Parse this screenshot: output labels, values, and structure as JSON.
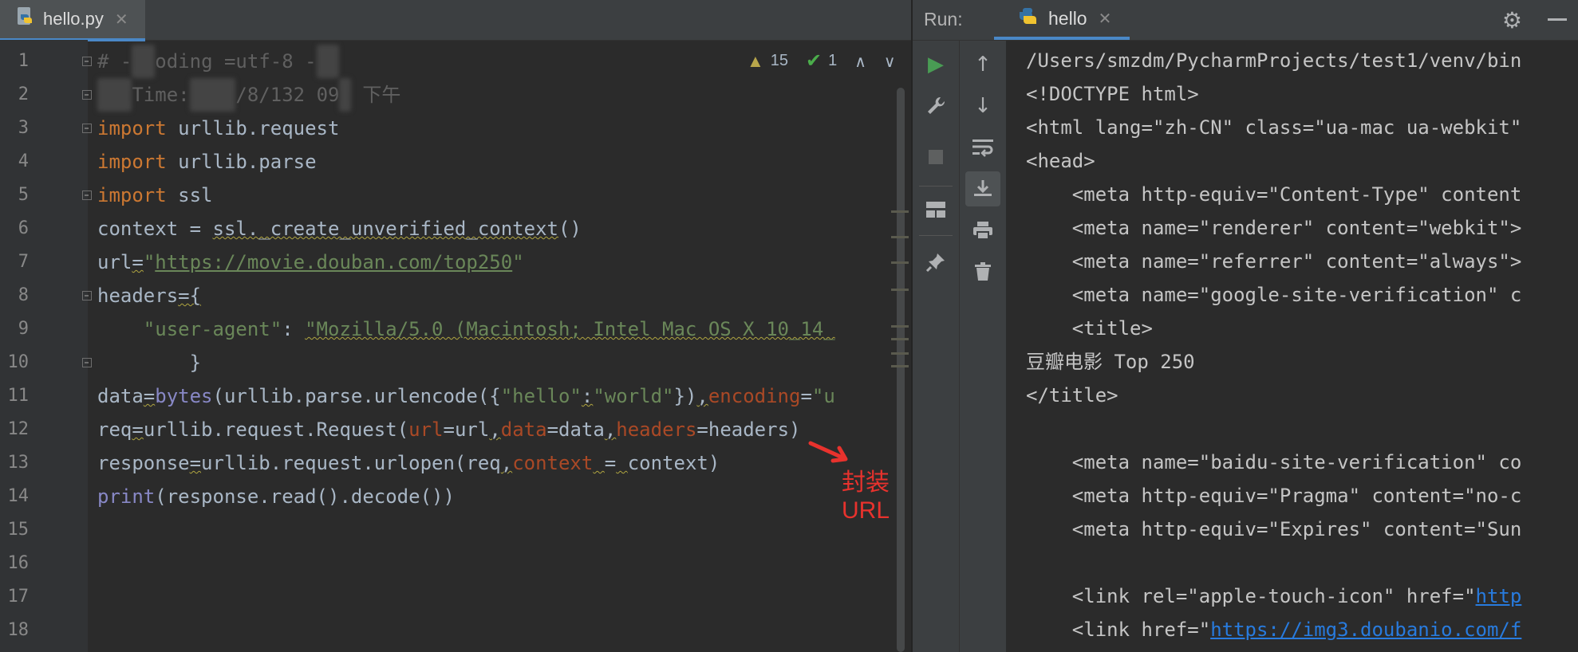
{
  "editor": {
    "tab": {
      "filename": "hello.py",
      "close": "✕"
    },
    "inspections": {
      "warnings": "15",
      "checks": "1",
      "prev": "∧",
      "next": "∨"
    },
    "line_numbers": [
      "1",
      "2",
      "3",
      "4",
      "5",
      "6",
      "7",
      "8",
      "9",
      "10",
      "11",
      "12",
      "13",
      "14",
      "15",
      "16",
      "17",
      "18"
    ],
    "code": {
      "l1_a": "# -",
      "l1_b": "oding",
      "l1_c": " =utf-8 ",
      "l1_d": "-",
      "l2_a": "Time:",
      "l2_b": "/8/132",
      "l2_c": "09",
      "l2_d": "下午",
      "l3_kw": "import",
      "l3_rest": " urllib.request",
      "l4_kw": "import",
      "l4_rest": " urllib.parse",
      "l5_kw": "import",
      "l5_rest": " ssl",
      "l6_a": "context = ",
      "l6_b": "ssl._create_unverified_context",
      "l6_c": "()",
      "l7_a": "url",
      "l7_b": "=",
      "l7_q1": "\"",
      "l7_url": "https://movie.douban.com/top250",
      "l7_q2": "\"",
      "l8_a": "headers",
      "l8_b": "={",
      "l9_indent": "    ",
      "l9_key": "\"user-agent\"",
      "l9_colon": ": ",
      "l9_val": "\"Mozilla/5.0 (Macintosh; Intel Mac OS X 10_14_",
      "l10_a": "        }",
      "l11_a": "data",
      "l11_b": "=",
      "l11_bytes": "bytes",
      "l11_c": "(urllib.parse.urlencode({",
      "l11_s1": "\"hello\"",
      "l11_d": ":",
      "l11_s2": "\"world\"",
      "l11_e": "})",
      "l11_comma": ",",
      "l11_enc": "encoding",
      "l11_f": "=",
      "l11_s3": "\"u",
      "l12_a": "req",
      "l12_b": "=",
      "l12_c": "urllib.request.Request(",
      "l12_p1": "url",
      "l12_d": "=url",
      "l12_c1": ",",
      "l12_p2": "data",
      "l12_e": "=data",
      "l12_c2": ",",
      "l12_p3": "headers",
      "l12_f": "=headers)",
      "l13_a": "response",
      "l13_b": "=",
      "l13_c": "urllib.request.urlopen(req",
      "l13_c1": ",",
      "l13_p1": "context",
      "l13_sp": " ",
      "l13_eq": "=",
      "l13_sp2": " ",
      "l13_d": "context)",
      "l14_print": "print",
      "l14_rest": "(response.read().decode())"
    },
    "annotation": "封装URL"
  },
  "run": {
    "label": "Run:",
    "tab": {
      "name": "hello",
      "close": "✕"
    },
    "console_lines": [
      "/Users/smzdm/PycharmProjects/test1/venv/bin",
      "<!DOCTYPE html>",
      "<html lang=\"zh-CN\" class=\"ua-mac ua-webkit\"",
      "<head>",
      "    <meta http-equiv=\"Content-Type\" content",
      "    <meta name=\"renderer\" content=\"webkit\">",
      "    <meta name=\"referrer\" content=\"always\">",
      "    <meta name=\"google-site-verification\" c",
      "    <title>",
      "豆瓣电影 Top 250",
      "</title>",
      "",
      "    <meta name=\"baidu-site-verification\" co",
      "    <meta http-equiv=\"Pragma\" content=\"no-c",
      "    <meta http-equiv=\"Expires\" content=\"Sun",
      ""
    ],
    "console_link_lines": [
      {
        "prefix": "    <link rel=\"apple-touch-icon\" href=\"",
        "link": "http"
      },
      {
        "prefix": "    <link href=\"",
        "link": "https://img3.doubanio.com/f"
      }
    ]
  },
  "colors": {
    "editor_bg": "#2b2b2b",
    "keyword": "#cc7832",
    "string": "#6a8759",
    "link": "#287bde",
    "accent_tab": "#4a88c7",
    "annotation": "#e8322d",
    "run_green": "#499c54"
  },
  "icons": [
    "python-file-icon",
    "close-icon",
    "warning-icon",
    "check-icon",
    "chevron-up-icon",
    "chevron-down-icon",
    "run-icon",
    "wrench-icon",
    "stop-icon",
    "layout-icon",
    "pin-icon",
    "arrow-up-icon",
    "arrow-down-icon",
    "soft-wrap-icon",
    "scroll-to-end-icon",
    "print-icon",
    "trash-icon",
    "gear-icon",
    "minimize-icon"
  ]
}
